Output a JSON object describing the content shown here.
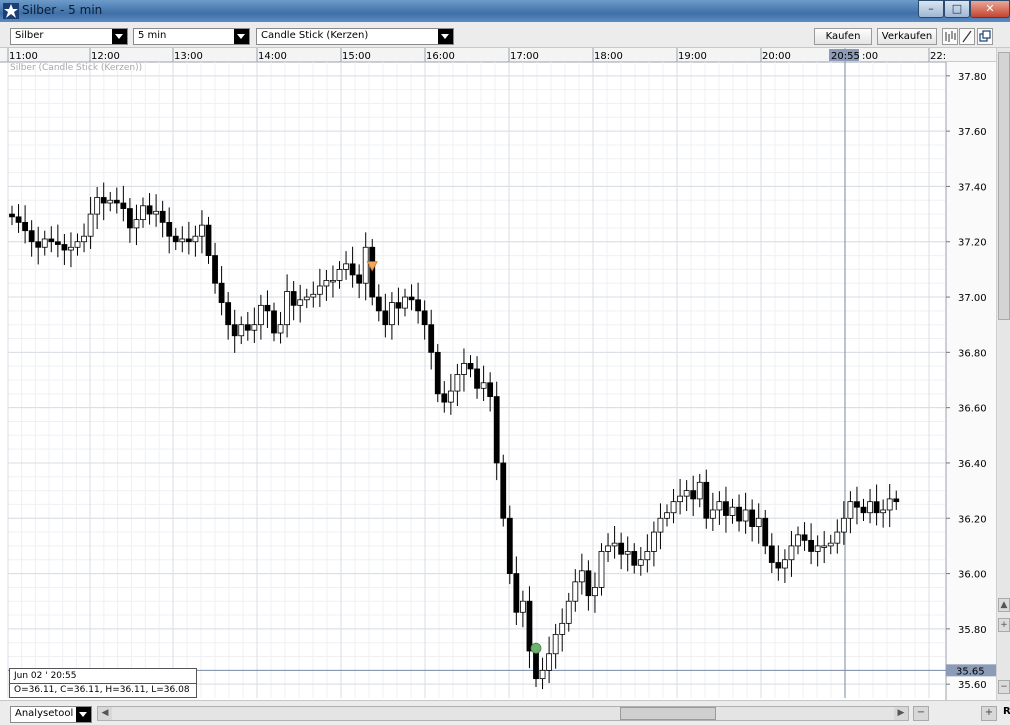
{
  "window": {
    "title": "Silber - 5 min",
    "minimize_label": "–",
    "maximize_label": "□",
    "close_label": "✕"
  },
  "toolbar": {
    "symbol": "Silber",
    "interval": "5 min",
    "chart_type": "Candle Stick (Kerzen)",
    "buy_label": "Kaufen",
    "sell_label": "Verkaufen",
    "icons": [
      "bars-icon",
      "draw-line-icon",
      "new-window-icon"
    ]
  },
  "chart": {
    "series_label": "Silber (Candle Stick (Kerzen))",
    "current_price": "35.65",
    "crosshair_time": "20:55",
    "colors": {
      "up": "#ffffff",
      "down": "#000000",
      "grid": "#d8dde4",
      "price_line": "#7a8aa6",
      "marker_buy": "#70b070",
      "marker_sell": "#f0a860"
    }
  },
  "ohlc_box": {
    "date": "Jun 02 ' 20:55",
    "values": "O=36.11, C=36.11, H=36.11, L=36.08"
  },
  "bottombar": {
    "analysis_label": "Analysetool",
    "right_label": "R",
    "zoom_out": "−",
    "zoom_in": "+"
  },
  "chart_data": {
    "type": "candlestick",
    "title": "",
    "x_tick_labels": [
      "11:00",
      "12:00",
      "13:00",
      "14:00",
      "15:00",
      "16:00",
      "17:00",
      "18:00",
      "19:00",
      "20:00",
      "20:55",
      "21:00",
      "22:"
    ],
    "y_tick_labels": [
      "37.80",
      "37.60",
      "37.40",
      "37.20",
      "37.00",
      "36.80",
      "36.60",
      "36.40",
      "36.20",
      "36.00",
      "35.80",
      "35.60"
    ],
    "ylim": [
      35.55,
      37.85
    ],
    "ohlc_pattern": "daily closing path",
    "closes": [
      37.29,
      37.27,
      37.24,
      37.2,
      37.18,
      37.21,
      37.2,
      37.19,
      37.17,
      37.18,
      37.2,
      37.22,
      37.3,
      37.36,
      37.34,
      37.35,
      37.34,
      37.32,
      37.25,
      37.28,
      37.33,
      37.3,
      37.31,
      37.27,
      37.22,
      37.2,
      37.21,
      37.2,
      37.22,
      37.26,
      37.15,
      37.05,
      36.98,
      36.9,
      36.86,
      36.9,
      36.88,
      36.9,
      36.97,
      36.95,
      36.87,
      36.9,
      37.02,
      36.97,
      36.99,
      37.0,
      37.01,
      37.04,
      37.06,
      37.06,
      37.1,
      37.12,
      37.08,
      37.05,
      37.18,
      37.0,
      36.95,
      36.9,
      36.98,
      36.96,
      37.0,
      36.99,
      36.95,
      36.9,
      36.8,
      36.65,
      36.62,
      36.66,
      36.72,
      36.76,
      36.74,
      36.67,
      36.69,
      36.64,
      36.4,
      36.2,
      36.0,
      35.86,
      35.9,
      35.72,
      35.62,
      35.65,
      35.71,
      35.78,
      35.82,
      35.9,
      35.97,
      36.01,
      35.92,
      35.95,
      36.08,
      36.1,
      36.11,
      36.07,
      36.08,
      36.03,
      36.05,
      36.08,
      36.15,
      36.2,
      36.22,
      36.26,
      36.28,
      36.3,
      36.27,
      36.33,
      36.2,
      36.23,
      36.26,
      36.21,
      36.24,
      36.19,
      36.23,
      36.17,
      36.2,
      36.1,
      36.04,
      36.02,
      36.05,
      36.1,
      36.14,
      36.12,
      36.08,
      36.1,
      36.1,
      36.11,
      36.15,
      36.2,
      36.26,
      36.24,
      36.22,
      36.26,
      36.22,
      36.23,
      36.27,
      36.26
    ],
    "markers": [
      {
        "type": "sell",
        "shape": "triangle-down",
        "price": 37.11,
        "index": 55
      },
      {
        "type": "buy",
        "shape": "circle",
        "price": 35.73,
        "index": 80
      }
    ]
  }
}
